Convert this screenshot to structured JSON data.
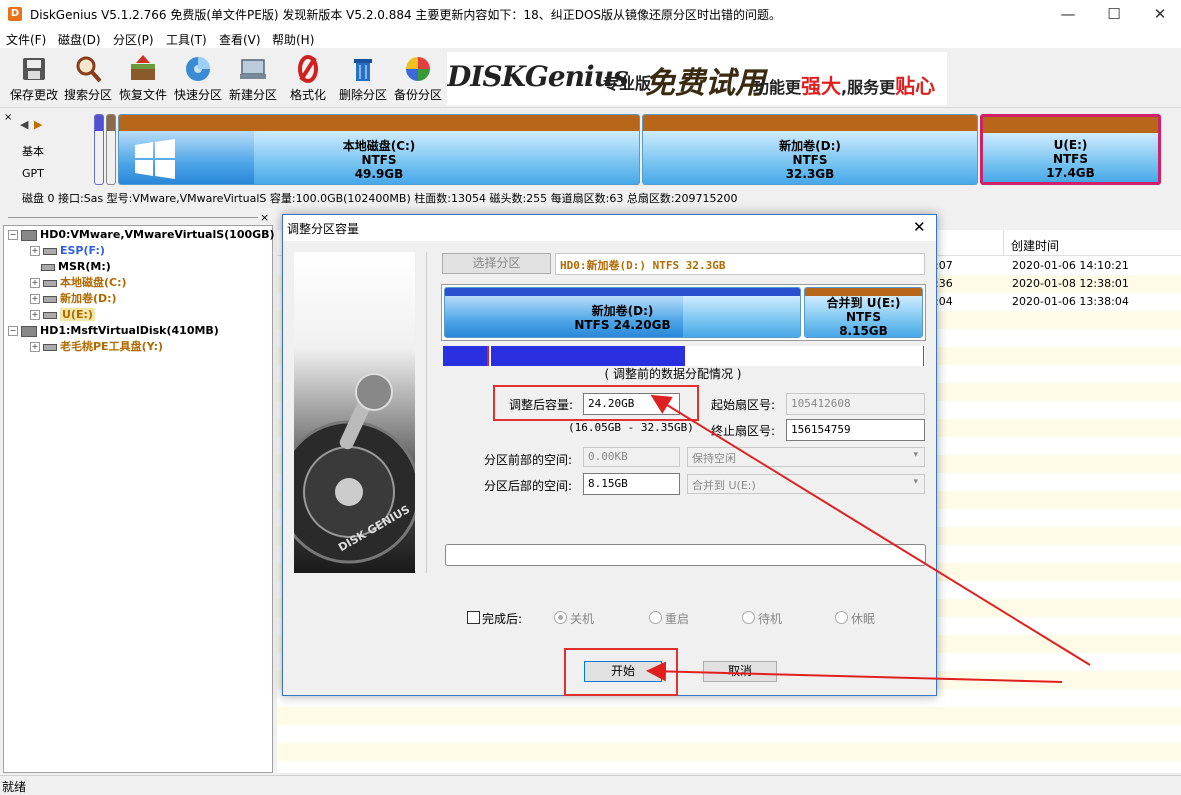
{
  "window": {
    "app_icon_text": "D",
    "title": "DiskGenius V5.1.2.766 免费版(单文件PE版)   发现新版本 V5.2.0.884 主要更新内容如下：18、纠正DOS版从镜像还原分区时出错的问题。",
    "minimize": "—",
    "maximize": "☐",
    "close": "✕"
  },
  "menu": [
    "文件(F)",
    "磁盘(D)",
    "分区(P)",
    "工具(T)",
    "查看(V)",
    "帮助(H)"
  ],
  "toolbar": [
    {
      "label": "保存更改",
      "icon": "save-icon"
    },
    {
      "label": "搜索分区",
      "icon": "magnifier-icon"
    },
    {
      "label": "恢复文件",
      "icon": "recover-box-icon"
    },
    {
      "label": "快速分区",
      "icon": "quick-partition-disc-icon"
    },
    {
      "label": "新建分区",
      "icon": "new-partition-icon"
    },
    {
      "label": "格式化",
      "icon": "format-icon"
    },
    {
      "label": "删除分区",
      "icon": "trash-icon"
    },
    {
      "label": "备份分区",
      "icon": "backup-pie-icon"
    }
  ],
  "banner": {
    "logo": "DISKGenius",
    "edition": "专业版",
    "free_trial": "免费试用",
    "slogan_1": "功能更",
    "slogan_2": "强大",
    "slogan_3": ",服务更",
    "slogan_4": "贴心"
  },
  "diskmap": {
    "nav_left": "◀",
    "nav_right": "▶",
    "basic": "基本",
    "gpt": "GPT",
    "partitions": [
      {
        "name": "本地磁盘(C:)",
        "fs": "NTFS",
        "size": "49.9GB",
        "used_fraction": 0.26
      },
      {
        "name": "新加卷(D:)",
        "fs": "NTFS",
        "size": "32.3GB",
        "used_fraction": 0.0
      },
      {
        "name": "U(E:)",
        "fs": "NTFS",
        "size": "17.4GB",
        "used_fraction": 0.0,
        "selected": true
      }
    ]
  },
  "disk_info": "磁盘 0 接口:Sas  型号:VMware,VMwareVirtualS  容量:100.0GB(102400MB)  柱面数:13054  磁头数:255  每道扇区数:63  总扇区数:209715200",
  "tree": {
    "close": "×",
    "nodes": [
      {
        "label": "HD0:VMware,VMwareVirtualS(100GB)",
        "level": 0,
        "color": "#000000",
        "type": "disk"
      },
      {
        "label": "ESP(F:)",
        "level": 1,
        "color": "#3060e0",
        "type": "partition"
      },
      {
        "label": "MSR(M:)",
        "level": 1,
        "color": "#000000",
        "type": "partition"
      },
      {
        "label": "本地磁盘(C:)",
        "level": 1,
        "color": "#b06a00",
        "type": "partition"
      },
      {
        "label": "新加卷(D:)",
        "level": 1,
        "color": "#b06a00",
        "type": "partition"
      },
      {
        "label": "U(E:)",
        "level": 1,
        "color": "#b06a00",
        "type": "partition",
        "selected": true
      },
      {
        "label": "HD1:MsftVirtualDisk(410MB)",
        "level": 0,
        "color": "#000000",
        "type": "disk"
      },
      {
        "label": "老毛桃PE工具盘(Y:)",
        "level": 1,
        "color": "#b06a00",
        "type": "partition"
      }
    ]
  },
  "file_list": {
    "header_created": "创建时间",
    "rows": [
      {
        "partial": ":07",
        "created": "2020-01-06 14:10:21"
      },
      {
        "partial": ":36",
        "created": "2020-01-08 12:38:01"
      },
      {
        "partial": ":04",
        "created": "2020-01-06 13:38:04"
      }
    ]
  },
  "dialog": {
    "title": "调整分区容量",
    "close": "✕",
    "select_partition": "选择分区",
    "selected_partition": "HD0:新加卷(D:) NTFS 32.3GB",
    "left_part": {
      "name": "新加卷(D:)",
      "info": "NTFS 24.20GB"
    },
    "right_part": {
      "name": "合并到 U(E:)",
      "fs": "NTFS",
      "size": "8.15GB"
    },
    "data_caption": "( 调整前的数据分配情况 )",
    "resize_label": "调整后容量:",
    "resize_value": "24.20GB",
    "range": "(16.05GB - 32.35GB)",
    "start_sector_label": "起始扇区号:",
    "start_sector": "105412608",
    "end_sector_label": "终止扇区号:",
    "end_sector": "156154759",
    "before_label": "分区前部的空间:",
    "before_value": "0.00KB",
    "before_option": "保持空闲",
    "after_label": "分区后部的空间:",
    "after_value": "8.15GB",
    "after_option": "合并到 U(E:)",
    "complete_label": "完成后:",
    "radios": [
      "关机",
      "重启",
      "待机",
      "休眠"
    ],
    "start_button": "开始",
    "cancel_button": "取消",
    "art_label": "DISK GENIUS"
  },
  "status": "就绪"
}
